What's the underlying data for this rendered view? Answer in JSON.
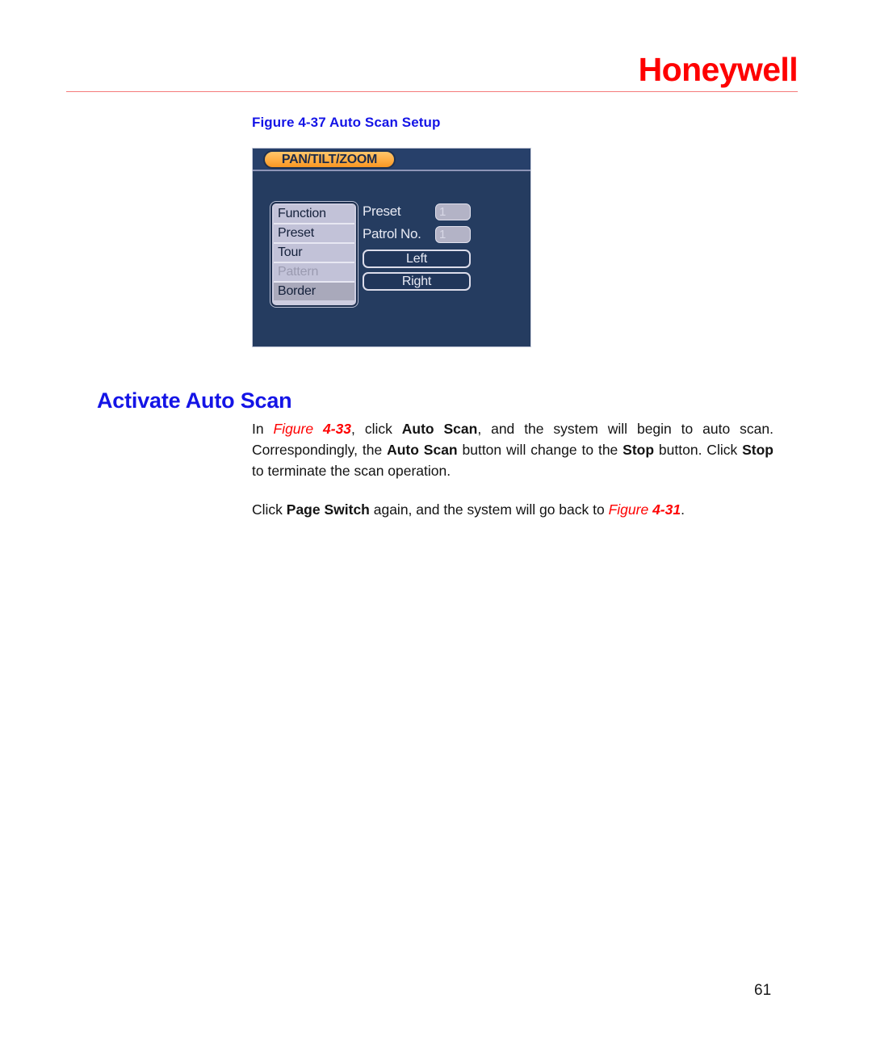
{
  "header": {
    "brand": "Honeywell"
  },
  "figure": {
    "caption_prefix": "Figure 4-37",
    "caption_text": "Auto Scan Setup",
    "caption_full": "Figure 4-37 Auto Scan Setup"
  },
  "ptz_dialog": {
    "title": "PAN/TILT/ZOOM",
    "menu_items": [
      {
        "label": "Function",
        "state": "normal"
      },
      {
        "label": "Preset",
        "state": "normal"
      },
      {
        "label": "Tour",
        "state": "normal"
      },
      {
        "label": "Pattern",
        "state": "disabled"
      },
      {
        "label": "Border",
        "state": "selected"
      }
    ],
    "fields": [
      {
        "label": "Preset",
        "value": "1"
      },
      {
        "label": "Patrol No.",
        "value": "1"
      }
    ],
    "buttons": [
      {
        "label": "Left"
      },
      {
        "label": "Right"
      }
    ],
    "colors": {
      "background": "#253c60",
      "title_tab": "#ffb24a",
      "list_background": "#c2c2d8",
      "selected_row": "#a9a9bb"
    }
  },
  "section": {
    "heading": "Activate Auto Scan"
  },
  "body": {
    "paragraph1": {
      "t1": "In ",
      "figref1_word": "Figure",
      "figref1_num": " 4-33",
      "t2": ", click ",
      "b1": "Auto Scan",
      "t3": ", and the system will begin to auto scan. Correspondingly, the ",
      "b2": "Auto Scan",
      "t4": " button will change to the ",
      "b3": "Stop",
      "t5": " button. Click ",
      "b4": "Stop",
      "t6": " to terminate the scan operation."
    },
    "paragraph2": {
      "t1": "Click ",
      "b1": "Page Switch",
      "t2": " again, and the system will go back to ",
      "figref_word": "Figure",
      "figref_num": " 4-31",
      "t3": "."
    }
  },
  "footer": {
    "page_number": "61"
  },
  "colors": {
    "brand_red": "#fe0000",
    "heading_blue": "#1414e6",
    "rule_red": "#f47a7a"
  }
}
